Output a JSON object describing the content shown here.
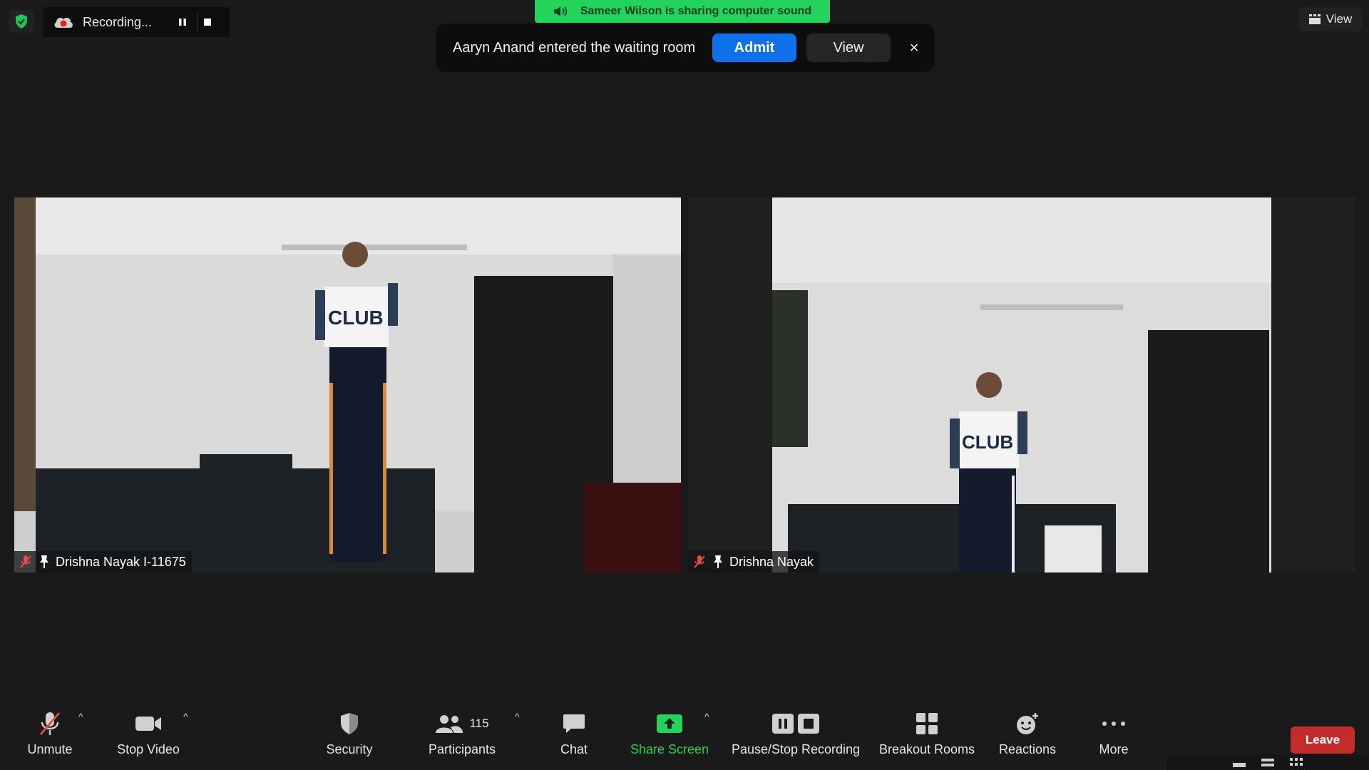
{
  "top_left": {
    "security_icon": "shield-check-icon",
    "recording": {
      "label": "Recording...",
      "pause_icon": "pause-icon",
      "stop_icon": "stop-icon"
    }
  },
  "share_banner": {
    "text": "Sameer Wilson is sharing computer sound",
    "icon": "speaker-icon"
  },
  "notification": {
    "message": "Aaryn Anand entered the waiting room",
    "admit_label": "Admit",
    "view_label": "View",
    "close_label": "×"
  },
  "view_button": {
    "label": "View",
    "icon": "grid-icon"
  },
  "participants_tiles": [
    {
      "name": "Drishna Nayak I-11675",
      "muted": true,
      "pinned": true
    },
    {
      "name": "Drishna Nayak",
      "muted": true,
      "pinned": true
    }
  ],
  "toolbar": {
    "unmute": "Unmute",
    "stop_video": "Stop Video",
    "security": "Security",
    "participants": "Participants",
    "participants_count": "115",
    "chat": "Chat",
    "share_screen": "Share Screen",
    "pause_stop_recording": "Pause/Stop Recording",
    "breakout_rooms": "Breakout Rooms",
    "reactions": "Reactions",
    "more": "More",
    "leave": "Leave"
  },
  "colors": {
    "background": "#1a1a1a",
    "admit_blue": "#0e71eb",
    "share_green": "#23d35b",
    "leave_red": "#c42b2b",
    "muted_red": "#e5484d"
  }
}
